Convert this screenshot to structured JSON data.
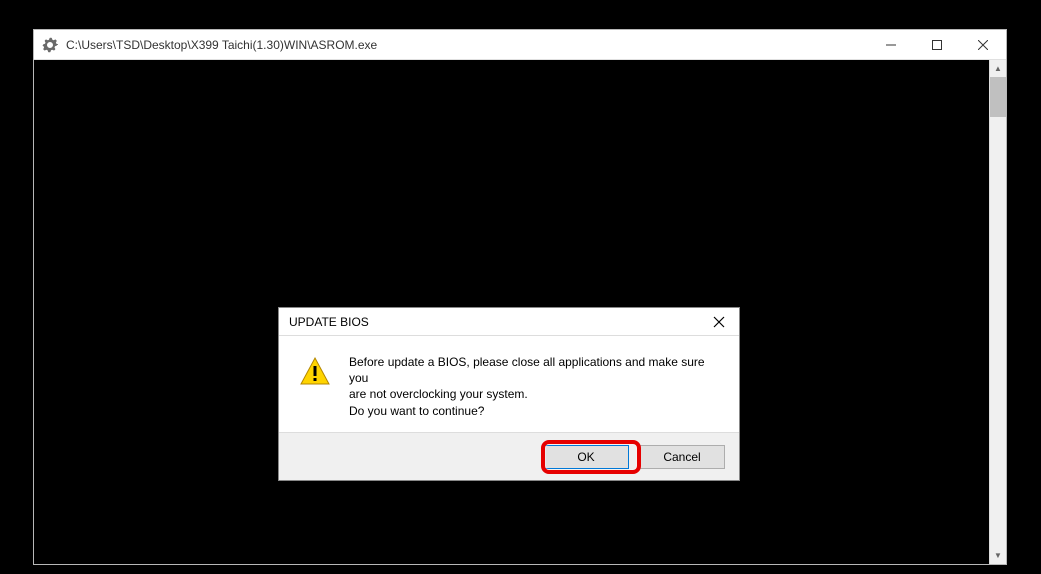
{
  "main_window": {
    "title": "C:\\Users\\TSD\\Desktop\\X399 Taichi(1.30)WIN\\ASROM.exe"
  },
  "dialog": {
    "title": "UPDATE BIOS",
    "message_line1": "Before update a BIOS, please close all applications and make sure you",
    "message_line2": "are not overclocking your system.",
    "message_line3": "Do you want to continue?",
    "ok_label": "OK",
    "cancel_label": "Cancel"
  }
}
